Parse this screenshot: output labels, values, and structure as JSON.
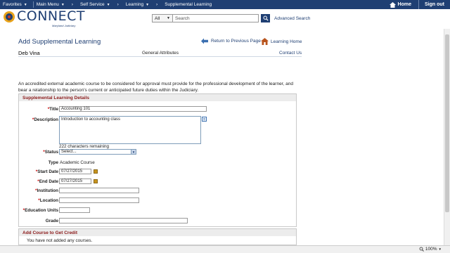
{
  "topnav": {
    "items": [
      "Favorites",
      "Main Menu",
      "Self Service",
      "Learning",
      "Supplemental Learning"
    ],
    "home": "Home",
    "signout": "Sign out"
  },
  "header": {
    "logo_text": "CONNECT",
    "logo_sub": "Maryland Judiciary",
    "search_scope": "All",
    "search_placeholder": "Search",
    "advanced_search": "Advanced Search"
  },
  "page": {
    "title": "Add Supplemental Learning",
    "return_link": "Return to Previous Page",
    "learning_home": "Learning Home",
    "person_name": "Deb Vina",
    "general_attributes": "General Attributes",
    "contact_us": "Contact Us",
    "intro": "An accredited external academic course to be considered for approval must provide for the professional development of the learner, and bear a relationship to the person's current or anticipated future duties within the Judiciary."
  },
  "details": {
    "header": "Supplemental Learning Details",
    "title_label": "Title",
    "title_value": "Accounting 101",
    "description_label": "Description",
    "description_value": "Introduction to accounting class",
    "chars_remaining": "222 characters remaining",
    "status_label": "Status",
    "status_value": "Select...",
    "type_label": "Type",
    "type_value": "Academic Course",
    "start_label": "Start Date",
    "start_value": "07/27/2015",
    "end_label": "End Date",
    "end_value": "07/27/2015",
    "institution_label": "Institution",
    "location_label": "Location",
    "units_label": "Education Units",
    "grade_label": "Grade",
    "required_marker": "*"
  },
  "credit": {
    "header": "Add Course to Get Credit",
    "empty_text": "You have not added any courses."
  },
  "statusbar": {
    "zoom": "100%"
  },
  "colors": {
    "nav_bg": "#1f3f73",
    "section_header_text": "#8b1a1a",
    "link": "#1f3f73"
  }
}
